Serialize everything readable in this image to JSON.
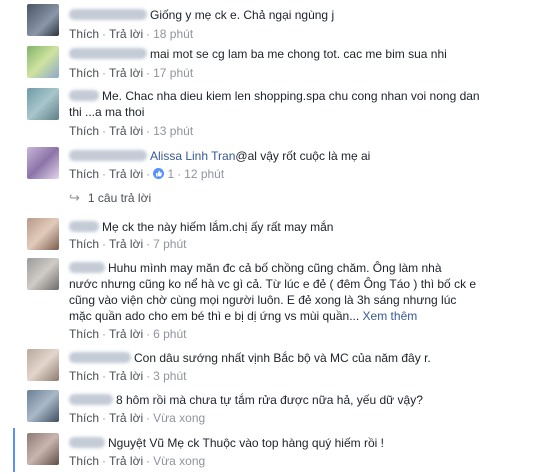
{
  "comments": [
    {
      "text": "Giống y mẹ ck e. Chả ngại ngùng j",
      "like_label": "Thích",
      "reply_label": "Trả lời",
      "time": "18 phút"
    },
    {
      "text": "mai mot se cg lam ba me chong tot. cac me bim sua nhi",
      "like_label": "Thích",
      "reply_label": "Trả lời",
      "time": "17 phút"
    },
    {
      "text_line1": "Me. Chac nha dieu kiem len shopping.spa chu cong nhan voi nong dan",
      "text_line2": "thi ...a ma thoi",
      "like_label": "Thích",
      "reply_label": "Trả lời",
      "time": "13 phút"
    },
    {
      "tag": "Alissa Linh Tran",
      "text": "@al vậy rốt cuộc là mẹ ai",
      "like_label": "Thích",
      "reply_label": "Trả lời",
      "time": "12 phút",
      "replies_label": "1 câu trả lời"
    },
    {
      "text": "Mẹ ck the này hiếm lắm.chị ấy rất may mắn",
      "like_label": "Thích",
      "reply_label": "Trả lời",
      "time": "7 phút"
    },
    {
      "line1": "Huhu mình may măn đc cả bố chồng cũng chăm. Ông làm nhà",
      "line2": "nước nhưng cũng ko nể hà vc gì cả. Từ lúc e đẻ ( đêm Ông Táo ) thì bố ck e",
      "line3": "cũng vào viện chờ cùng mọi người luôn. E đẻ xong là 3h sáng nhưng lúc",
      "line4": "mặc quần ado cho em bé thì e bị dị ứng vs mùi quần...",
      "see_more": "Xem thêm",
      "like_label": "Thích",
      "reply_label": "Trả lời",
      "time": "6 phút"
    },
    {
      "text": "Con dâu sướng nhất vịnh Bắc bộ và MC của năm đây r.",
      "like_label": "Thích",
      "reply_label": "Trả lời",
      "time": "3 phút"
    },
    {
      "text": "8 hôm rồi mà chưa tự tắm rửa được nữa hả, yếu dữ vậy?",
      "like_label": "Thích",
      "reply_label": "Trả lời",
      "time": "Vừa xong"
    },
    {
      "name_tail": "Nguyệt Vũ",
      "text": "Mẹ ck Thuộc vào top hàng quý hiếm rồi !",
      "like_label": "Thích",
      "reply_label": "Trả lời",
      "time": "Vừa xong"
    }
  ]
}
